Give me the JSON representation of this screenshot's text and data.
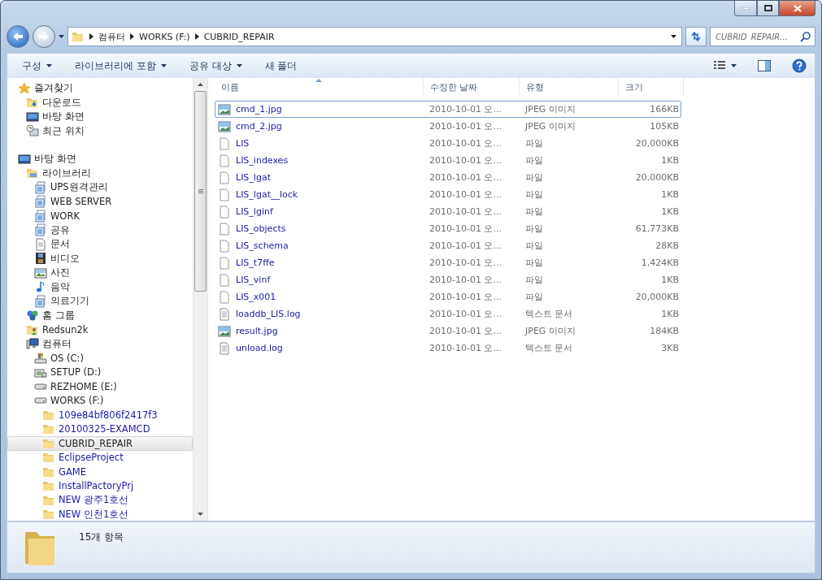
{
  "address": {
    "crumbs": [
      "컴퓨터",
      "WORKS (F:)",
      "CUBRID_REPAIR"
    ]
  },
  "search": {
    "placeholder": "CUBRID_REPAIR..."
  },
  "toolbar": [
    {
      "label": "구성",
      "dropdown": true
    },
    {
      "label": "라이브러리에 포함",
      "dropdown": true
    },
    {
      "label": "공유 대상",
      "dropdown": true
    },
    {
      "label": "새 폴더",
      "dropdown": false
    }
  ],
  "nav": [
    {
      "label": "즐겨찾기",
      "kind": "star",
      "selected": false,
      "children": [
        {
          "label": "다운로드",
          "kind": "downloads",
          "selected": false
        },
        {
          "label": "바탕 화면",
          "kind": "desktop",
          "selected": false
        },
        {
          "label": "최근 위치",
          "kind": "recent",
          "selected": false
        }
      ]
    },
    {
      "label": "바탕 화면",
      "kind": "desktop",
      "selected": false,
      "children": [
        {
          "label": "라이브러리",
          "kind": "library",
          "selected": false,
          "children": [
            {
              "label": "UPS원격관리",
              "kind": "lib",
              "selected": false
            },
            {
              "label": "WEB SERVER",
              "kind": "lib",
              "selected": false
            },
            {
              "label": "WORK",
              "kind": "lib",
              "selected": false
            },
            {
              "label": "공유",
              "kind": "lib",
              "selected": false
            },
            {
              "label": "문서",
              "kind": "docs",
              "selected": false
            },
            {
              "label": "비디오",
              "kind": "video",
              "selected": false
            },
            {
              "label": "사진",
              "kind": "pictures",
              "selected": false
            },
            {
              "label": "음악",
              "kind": "music",
              "selected": false
            },
            {
              "label": "의료기기",
              "kind": "lib",
              "selected": false
            }
          ]
        },
        {
          "label": "홈 그룹",
          "kind": "homegroup",
          "selected": false
        },
        {
          "label": "Redsun2k",
          "kind": "user",
          "selected": false
        },
        {
          "label": "컴퓨터",
          "kind": "computer",
          "selected": false,
          "children": [
            {
              "label": "OS (C:)",
              "kind": "osdrive",
              "selected": false
            },
            {
              "label": "SETUP (D:)",
              "kind": "cddrive",
              "selected": false
            },
            {
              "label": "REZHOME (E:)",
              "kind": "drive",
              "selected": false
            },
            {
              "label": "WORKS (F:)",
              "kind": "drive",
              "selected": false,
              "children": [
                {
                  "label": "109e84bf806f2417f3",
                  "kind": "folder",
                  "selected": false,
                  "compressed": true
                },
                {
                  "label": "20100325-EXAMCD",
                  "kind": "folder",
                  "selected": false,
                  "compressed": true
                },
                {
                  "label": "CUBRID_REPAIR",
                  "kind": "folder",
                  "selected": true,
                  "compressed": false
                },
                {
                  "label": "EclipseProject",
                  "kind": "folder",
                  "selected": false,
                  "compressed": true
                },
                {
                  "label": "GAME",
                  "kind": "folder",
                  "selected": false,
                  "compressed": true
                },
                {
                  "label": "InstallPactoryPrj",
                  "kind": "folder",
                  "selected": false,
                  "compressed": true
                },
                {
                  "label": "NEW 광주1호선",
                  "kind": "folder",
                  "selected": false,
                  "compressed": true
                },
                {
                  "label": "NEW 인천1호선",
                  "kind": "folder",
                  "selected": false,
                  "compressed": true
                }
              ]
            }
          ]
        }
      ]
    }
  ],
  "columns": [
    {
      "label": "이름",
      "sorted": true
    },
    {
      "label": "수정한 날짜",
      "sorted": false
    },
    {
      "label": "유형",
      "sorted": false
    },
    {
      "label": "크기",
      "sorted": false
    }
  ],
  "files": [
    {
      "name": "cmd_1.jpg",
      "date": "2010-10-01 오...",
      "type": "JPEG 이미지",
      "size": "166KB",
      "kind": "image",
      "focused": true,
      "compressed": true
    },
    {
      "name": "cmd_2.jpg",
      "date": "2010-10-01 오...",
      "type": "JPEG 이미지",
      "size": "105KB",
      "kind": "image",
      "focused": false,
      "compressed": true
    },
    {
      "name": "LIS",
      "date": "2010-10-01 오...",
      "type": "파일",
      "size": "20,000KB",
      "kind": "blank",
      "focused": false,
      "compressed": true
    },
    {
      "name": "LIS_indexes",
      "date": "2010-10-01 오...",
      "type": "파일",
      "size": "1KB",
      "kind": "blank",
      "focused": false,
      "compressed": true
    },
    {
      "name": "LIS_lgat",
      "date": "2010-10-01 오...",
      "type": "파일",
      "size": "20,000KB",
      "kind": "blank",
      "focused": false,
      "compressed": true
    },
    {
      "name": "LIS_lgat__lock",
      "date": "2010-10-01 오...",
      "type": "파일",
      "size": "1KB",
      "kind": "blank",
      "focused": false,
      "compressed": true
    },
    {
      "name": "LIS_lginf",
      "date": "2010-10-01 오...",
      "type": "파일",
      "size": "1KB",
      "kind": "blank",
      "focused": false,
      "compressed": true
    },
    {
      "name": "LIS_objects",
      "date": "2010-10-01 오...",
      "type": "파일",
      "size": "61,773KB",
      "kind": "blank",
      "focused": false,
      "compressed": true
    },
    {
      "name": "LIS_schema",
      "date": "2010-10-01 오...",
      "type": "파일",
      "size": "28KB",
      "kind": "blank",
      "focused": false,
      "compressed": true
    },
    {
      "name": "LIS_t7ffe",
      "date": "2010-10-01 오...",
      "type": "파일",
      "size": "1,424KB",
      "kind": "blank",
      "focused": false,
      "compressed": true
    },
    {
      "name": "LIS_vinf",
      "date": "2010-10-01 오...",
      "type": "파일",
      "size": "1KB",
      "kind": "blank",
      "focused": false,
      "compressed": true
    },
    {
      "name": "LIS_x001",
      "date": "2010-10-01 오...",
      "type": "파일",
      "size": "20,000KB",
      "kind": "blank",
      "focused": false,
      "compressed": true
    },
    {
      "name": "loaddb_LIS.log",
      "date": "2010-10-01 오...",
      "type": "텍스트 문서",
      "size": "1KB",
      "kind": "text",
      "focused": false,
      "compressed": true
    },
    {
      "name": "result.jpg",
      "date": "2010-10-01 오...",
      "type": "JPEG 이미지",
      "size": "184KB",
      "kind": "image",
      "focused": false,
      "compressed": true
    },
    {
      "name": "unload.log",
      "date": "2010-10-01 오...",
      "type": "텍스트 문서",
      "size": "3KB",
      "kind": "text",
      "focused": false,
      "compressed": true
    }
  ],
  "status": {
    "count": "15개 항목"
  }
}
